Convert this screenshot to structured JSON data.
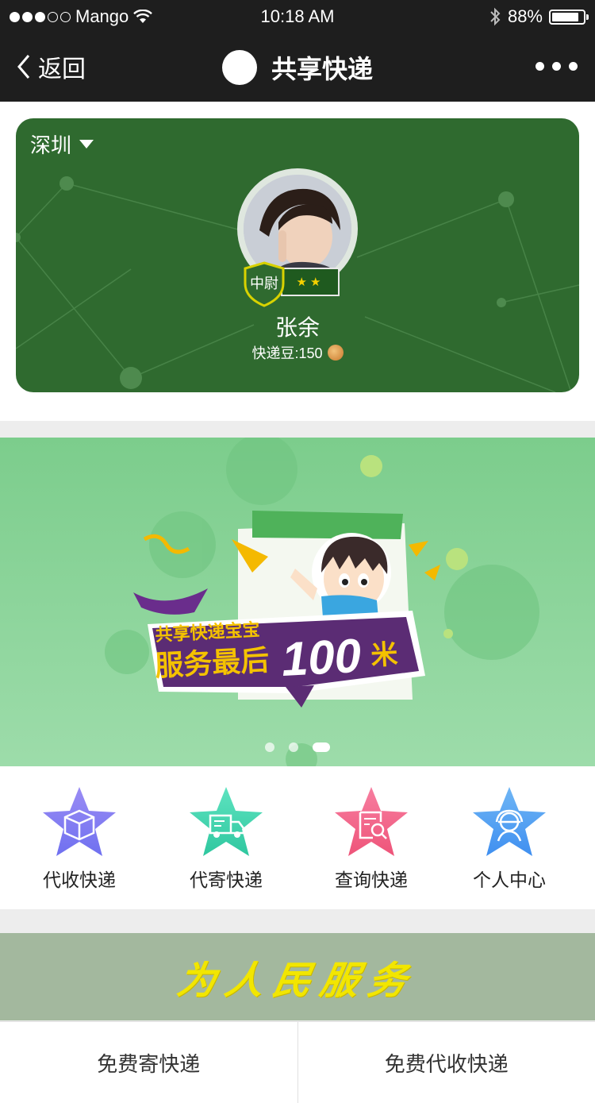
{
  "status_bar": {
    "carrier": "Mango",
    "time": "10:18 AM",
    "battery_text": "88%",
    "battery_level": 0.88
  },
  "nav": {
    "back_label": "返回",
    "title": "共享快递"
  },
  "profile": {
    "city": "深圳",
    "rank": "中尉",
    "rank_stars": "★★",
    "name": "张余",
    "beans_label": "快递豆:150"
  },
  "banner": {
    "headline_top": "共享快递宝宝",
    "headline_bottom": "服务最后",
    "headline_number": "100",
    "headline_unit": "米",
    "page_count": 3,
    "active_page": 3
  },
  "actions": [
    {
      "label": "代收快递",
      "icon": "package-icon",
      "color_top": "#9a8cf4",
      "color_bottom": "#6f70f0"
    },
    {
      "label": "代寄快递",
      "icon": "truck-icon",
      "color_top": "#5ee3c0",
      "color_bottom": "#2fc79f"
    },
    {
      "label": "查询快递",
      "icon": "search-document-icon",
      "color_top": "#f77ea0",
      "color_bottom": "#ee5479"
    },
    {
      "label": "个人中心",
      "icon": "person-icon",
      "color_top": "#6fb6f5",
      "color_bottom": "#3f8ff0"
    }
  ],
  "slogan": "为人民服务",
  "bottom_buttons": {
    "left": "免费寄快递",
    "right": "免费代收快递"
  },
  "colors": {
    "nav_bg": "#1e1e1e",
    "card_green": "#2f6a2f",
    "banner_green": "#7fd28f",
    "slogan_bg": "#a3b89e",
    "slogan_text": "#f2e600"
  }
}
